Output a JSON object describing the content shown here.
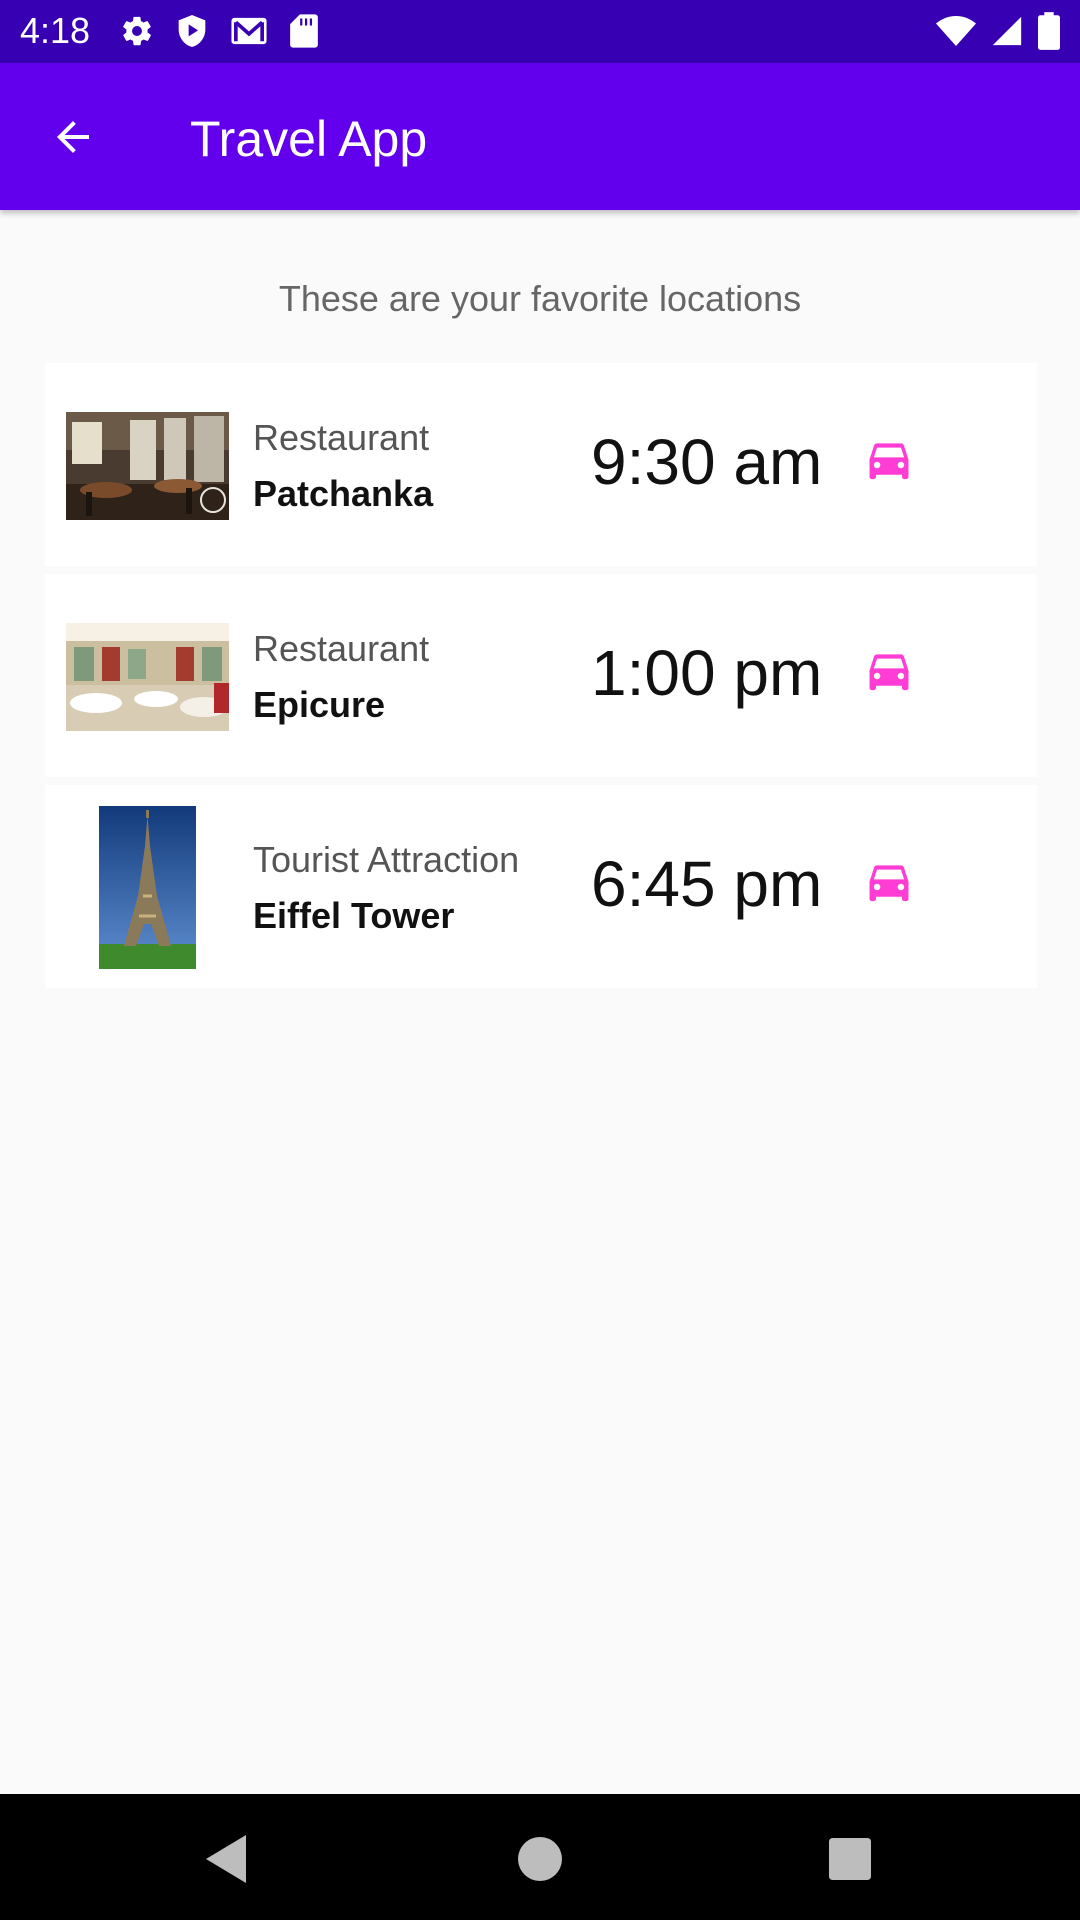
{
  "status_bar": {
    "time": "4:18",
    "left_icons": [
      "settings-icon",
      "play-protect-icon",
      "gmail-icon",
      "sd-card-icon"
    ],
    "right_icons": [
      "wifi-icon",
      "signal-icon",
      "battery-icon"
    ]
  },
  "app_bar": {
    "title": "Travel App",
    "back_icon": "arrow-back-icon",
    "color": "#6200ee"
  },
  "subtitle": "These are your favorite locations",
  "favorites": [
    {
      "category": "Restaurant",
      "name": "Patchanka",
      "time": "9:30 am",
      "icon": "car-icon"
    },
    {
      "category": "Restaurant",
      "name": "Epicure",
      "time": "1:00 pm",
      "icon": "car-icon"
    },
    {
      "category": "Tourist Attraction",
      "name": "Eiffel Tower",
      "time": "6:45 pm",
      "icon": "car-icon"
    }
  ],
  "accent_color": "#ff3dd5",
  "nav_bar": {
    "buttons": [
      "back-triangle-icon",
      "home-circle-icon",
      "recents-square-icon"
    ]
  }
}
